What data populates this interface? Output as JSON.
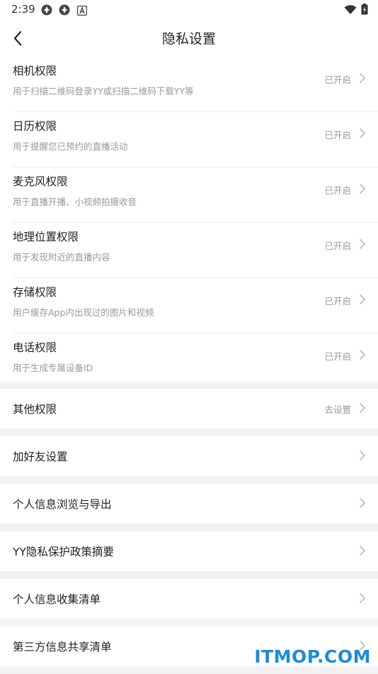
{
  "status_bar": {
    "time": "2:39",
    "left_icons": [
      "app-icon",
      "app-icon",
      "accessibility-icon"
    ],
    "right_icons": [
      "wifi-icon",
      "battery-icon"
    ]
  },
  "navbar": {
    "title": "隐私设置",
    "back_icon": "chevron-left-icon"
  },
  "permissions": [
    {
      "title": "相机权限",
      "desc": "用于扫描二维码登录YY或扫描二维码下载YY等",
      "status": "已开启"
    },
    {
      "title": "日历权限",
      "desc": "用于提醒您已预约的直播活动",
      "status": "已开启"
    },
    {
      "title": "麦克风权限",
      "desc": "用于直播开播、小视频拍摄收音",
      "status": "已开启"
    },
    {
      "title": "地理位置权限",
      "desc": "用于发现附近的直播内容",
      "status": "已开启"
    },
    {
      "title": "存储权限",
      "desc": "用户缓存App内出现过的图片和视频",
      "status": "已开启"
    },
    {
      "title": "电话权限",
      "desc": "用于生成专属设备ID",
      "status": "已开启"
    }
  ],
  "rows": [
    {
      "title": "其他权限",
      "status": "去设置"
    },
    {
      "title": "加好友设置",
      "status": ""
    },
    {
      "title": "个人信息浏览与导出",
      "status": ""
    },
    {
      "title": "YY隐私保护政策摘要",
      "status": ""
    },
    {
      "title": "个人信息收集清单",
      "status": ""
    },
    {
      "title": "第三方信息共享清单",
      "status": ""
    }
  ],
  "watermark": "ITMOP.COM",
  "colors": {
    "background": "#f2f2f4",
    "card": "#ffffff",
    "secondary_text": "#999999",
    "watermark": "#1a8cd8"
  }
}
